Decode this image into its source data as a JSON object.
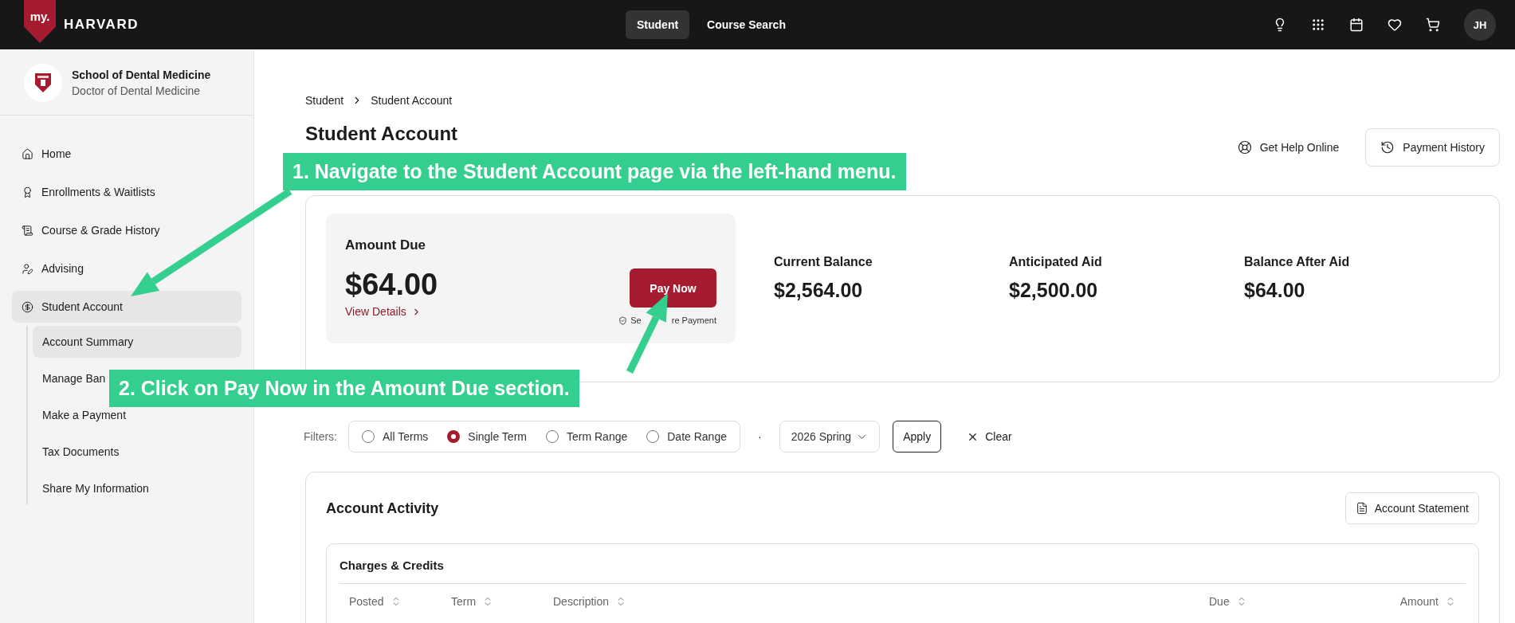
{
  "top_bar": {
    "logo": {
      "badge": "my.",
      "name": "HARVARD"
    },
    "tabs": [
      {
        "label": "Student",
        "selected": true
      },
      {
        "label": "Course Search",
        "selected": false
      }
    ],
    "avatar": "JH"
  },
  "sidebar": {
    "school": {
      "name": "School of Dental Medicine",
      "program": "Doctor of Dental Medicine"
    },
    "items": [
      {
        "label": "Home",
        "selected": false
      },
      {
        "label": "Enrollments & Waitlists",
        "selected": false
      },
      {
        "label": "Course & Grade History",
        "selected": false
      },
      {
        "label": "Advising",
        "selected": false
      },
      {
        "label": "Student Account",
        "selected": true,
        "children": [
          {
            "label": "Account Summary",
            "selected": true
          },
          {
            "label": "Manage Ban",
            "selected": false
          },
          {
            "label": "Make a Payment",
            "selected": false
          },
          {
            "label": "Tax Documents",
            "selected": false
          },
          {
            "label": "Share My Information",
            "selected": false
          }
        ]
      }
    ]
  },
  "breadcrumb": [
    "Student",
    "Student Account"
  ],
  "title": "Student Account",
  "actions": [
    {
      "label": "Get Help Online",
      "kind": "link"
    },
    {
      "label": "Payment History",
      "kind": "button"
    }
  ],
  "summary": {
    "amount_due": {
      "label": "Amount Due",
      "value": "$64.00",
      "link": "View Details",
      "button": "Pay Now",
      "note": [
        "Se",
        "re Payment"
      ]
    },
    "stats": [
      {
        "label": "Current Balance",
        "value": "$2,564.00"
      },
      {
        "label": "Anticipated Aid",
        "value": "$2,500.00"
      },
      {
        "label": "Balance After Aid",
        "value": "$64.00"
      }
    ]
  },
  "filters": {
    "label": "Filters:",
    "options": [
      {
        "label": "All Terms",
        "selected": false
      },
      {
        "label": "Single Term",
        "selected": true
      },
      {
        "label": "Term Range",
        "selected": false
      },
      {
        "label": "Date Range",
        "selected": false
      }
    ],
    "separator": "·",
    "term": "2026 Spring",
    "apply": "Apply",
    "clear": "Clear"
  },
  "activity": {
    "title": "Account Activity",
    "button": "Account Statement",
    "charges": {
      "title": "Charges & Credits",
      "columns": [
        "Posted",
        "Term",
        "Description",
        "Due",
        "Amount"
      ]
    }
  },
  "annotations": [
    {
      "text": "1. Navigate to the Student Account page via the left-hand menu."
    },
    {
      "text": "2. Click on Pay Now in the Amount Due section."
    }
  ]
}
